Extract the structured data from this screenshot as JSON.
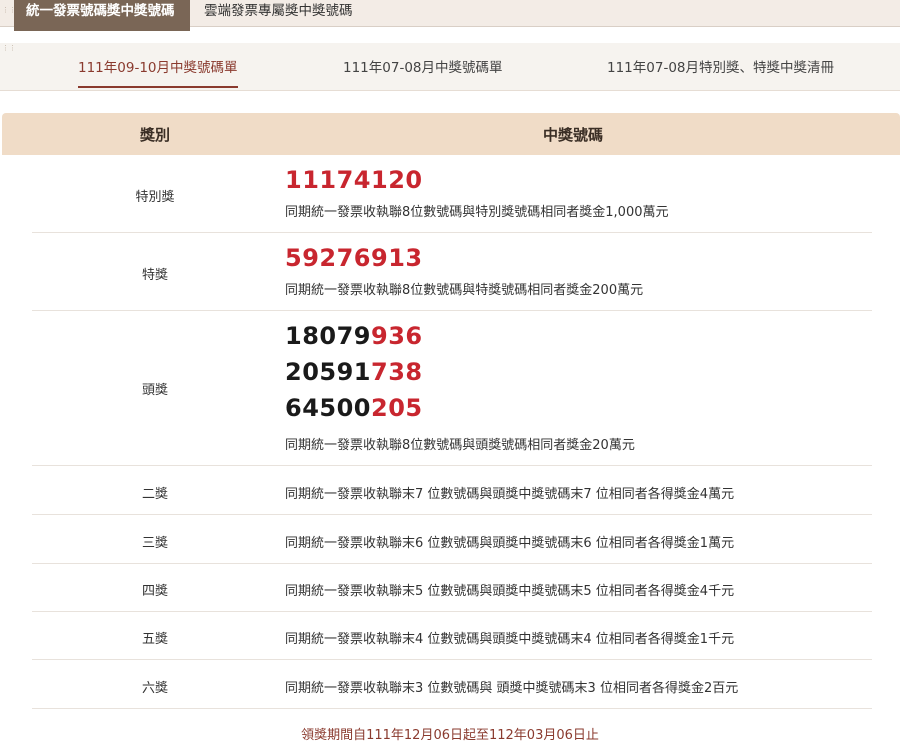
{
  "top_tabs": [
    {
      "label": "統一發票號碼獎中獎號碼",
      "active": true
    },
    {
      "label": "雲端發票專屬獎中獎號碼",
      "active": false
    }
  ],
  "sub_tabs": [
    {
      "label": "111年09-10月中獎號碼單",
      "active": true
    },
    {
      "label": "111年07-08月中獎號碼單",
      "active": false
    },
    {
      "label": "111年07-08月特別獎、特獎中獎清冊",
      "active": false
    }
  ],
  "table": {
    "headers": {
      "category": "獎別",
      "number": "中獎號碼"
    },
    "rows": [
      {
        "category": "特別獎",
        "number": "11174120",
        "detail": "同期統一發票收執聯8位數號碼與特別獎號碼相同者獎金1,000萬元"
      },
      {
        "category": "特獎",
        "number": "59276913",
        "detail": "同期統一發票收執聯8位數號碼與特獎號碼相同者獎金200萬元"
      },
      {
        "category": "頭獎",
        "numbers": [
          {
            "black": "18079",
            "red": "936"
          },
          {
            "black": "20591",
            "red": "738"
          },
          {
            "black": "64500",
            "red": "205"
          }
        ],
        "detail": "同期統一發票收執聯8位數號碼與頭獎號碼相同者獎金20萬元"
      },
      {
        "category": "二獎",
        "detail": "同期統一發票收執聯末7 位數號碼與頭獎中獎號碼末7 位相同者各得獎金4萬元"
      },
      {
        "category": "三獎",
        "detail": "同期統一發票收執聯末6 位數號碼與頭獎中獎號碼末6 位相同者各得獎金1萬元"
      },
      {
        "category": "四獎",
        "detail": "同期統一發票收執聯末5 位數號碼與頭獎中獎號碼末5 位相同者各得獎金4千元"
      },
      {
        "category": "五獎",
        "detail": "同期統一發票收執聯末4 位數號碼與頭獎中獎號碼末4 位相同者各得獎金1千元"
      },
      {
        "category": "六獎",
        "detail": "同期統一發票收執聯末3 位數號碼與 頭獎中獎號碼末3 位相同者各得獎金2百元"
      }
    ]
  },
  "footer": "領獎期間自111年12月06日起至112年03月06日止",
  "colors": {
    "accent": "#8a3a2e",
    "winning_red": "#c8262f",
    "header_bg": "#f0dcc7",
    "active_tab_bg": "#7a6656"
  }
}
